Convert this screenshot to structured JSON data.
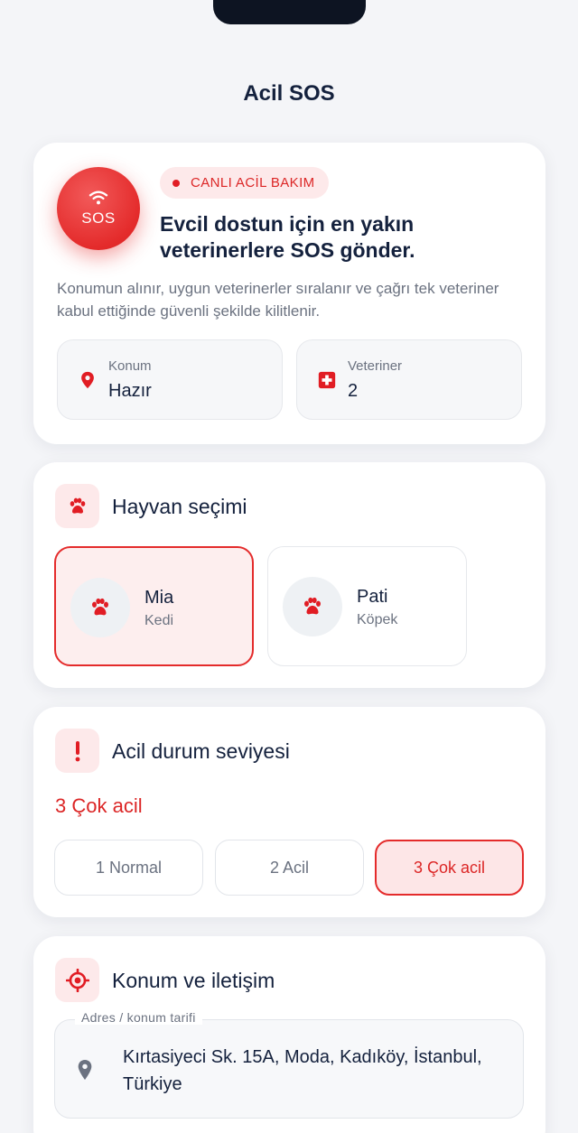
{
  "header": {
    "title": "Acil SOS"
  },
  "sos_card": {
    "sos_button_label": "SOS",
    "badge": "CANLI ACİL BAKIM",
    "headline": "Evcil dostun için en yakın veterinerlere SOS gönder.",
    "description": "Konumun alınır, uygun veterinerler sıralanır ve çağrı tek veteriner kabul ettiğinde güvenli şekilde kilitlenir.",
    "stats": [
      {
        "label": "Konum",
        "value": "Hazır",
        "icon": "location-pin-icon"
      },
      {
        "label": "Veteriner",
        "value": "2",
        "icon": "medical-cross-icon"
      }
    ]
  },
  "pet_section": {
    "title": "Hayvan seçimi",
    "icon": "paw-icon",
    "pets": [
      {
        "name": "Mia",
        "type": "Kedi",
        "selected": true
      },
      {
        "name": "Pati",
        "type": "Köpek",
        "selected": false
      }
    ]
  },
  "urgency_section": {
    "title": "Acil durum seviyesi",
    "icon": "exclamation-icon",
    "current": "3 Çok acil",
    "levels": [
      {
        "label": "1 Normal",
        "selected": false
      },
      {
        "label": "2 Acil",
        "selected": false
      },
      {
        "label": "3 Çok acil",
        "selected": true
      }
    ]
  },
  "location_section": {
    "title": "Konum ve iletişim",
    "icon": "crosshair-icon",
    "address_label": "Adres / konum tarifi",
    "address_value": "Kırtasiyeci Sk. 15A, Moda, Kadıköy, İstanbul, Türkiye"
  },
  "colors": {
    "accent": "#e42b2b",
    "accent_soft": "#fde9ea",
    "text": "#14213d",
    "muted": "#6b7280",
    "background": "#f4f5f8"
  }
}
